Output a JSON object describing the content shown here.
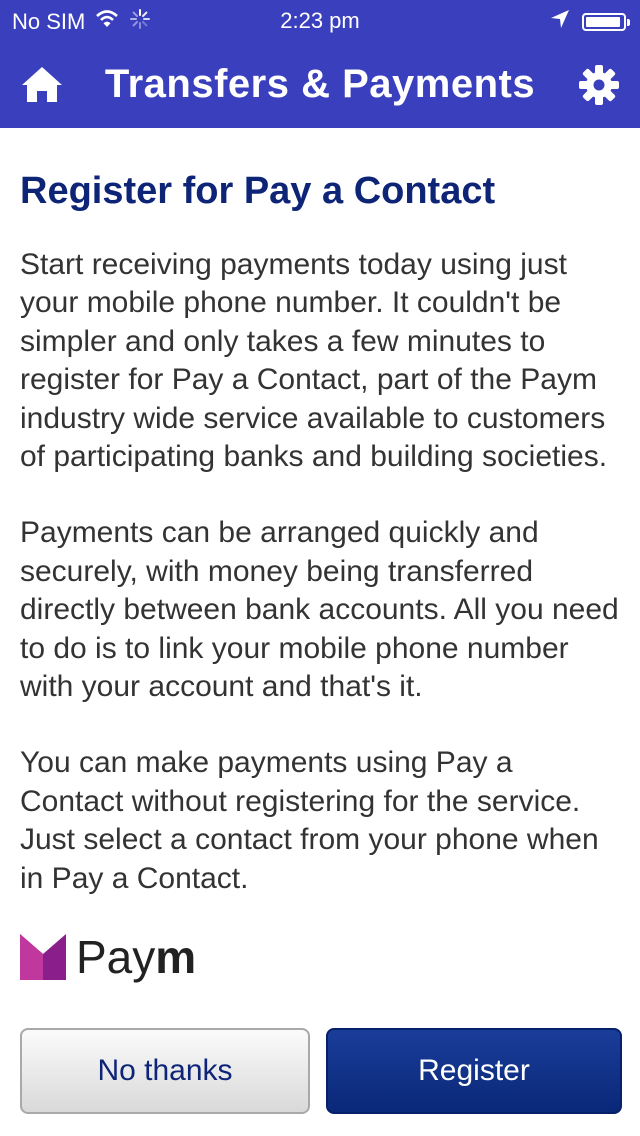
{
  "status_bar": {
    "carrier": "No SIM",
    "time": "2:23 pm"
  },
  "nav": {
    "title": "Transfers & Payments"
  },
  "content": {
    "title": "Register for Pay a Contact",
    "paragraphs": [
      "Start receiving payments today using just your mobile phone number. It couldn't be simpler and only takes a few minutes to register for Pay a Contact, part of the Paym industry wide service available to customers of participating banks and building societies.",
      "Payments can be arranged quickly and securely, with money being transferred directly between bank accounts. All you need to do is to link your mobile phone number with your account and that's it.",
      "You can make payments using Pay a Contact without registering for the service. Just select a contact from your phone when in Pay a Contact."
    ],
    "logo": {
      "text_regular": "Pay",
      "text_bold": "m"
    }
  },
  "buttons": {
    "no_thanks": "No thanks",
    "register": "Register"
  },
  "colors": {
    "header": "#3a3fbd",
    "title": "#0d2477",
    "primary_button": "#0a2878"
  }
}
